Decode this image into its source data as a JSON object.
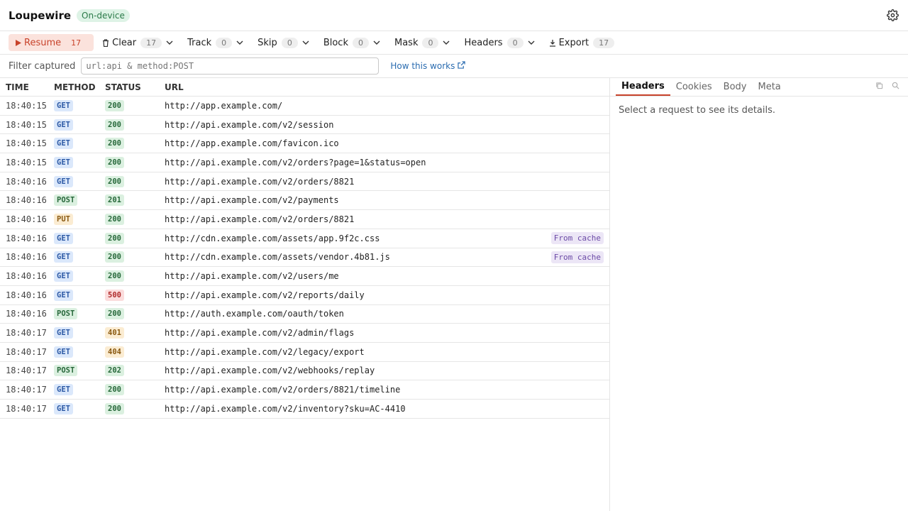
{
  "app": {
    "title": "Loupewire",
    "mode_badge": "On-device"
  },
  "toolbar": {
    "resume": {
      "label": "Resume",
      "count": "17"
    },
    "clear": {
      "label": "Clear",
      "count": "17"
    },
    "track": {
      "label": "Track",
      "count": "0"
    },
    "skip": {
      "label": "Skip",
      "count": "0"
    },
    "block": {
      "label": "Block",
      "count": "0"
    },
    "mask": {
      "label": "Mask",
      "count": "0"
    },
    "headers": {
      "label": "Headers",
      "count": "0"
    },
    "export": {
      "label": "Export",
      "count": "17"
    }
  },
  "filter": {
    "label": "Filter captured",
    "placeholder": "url:api & method:POST",
    "value": "",
    "help_link": "How this works"
  },
  "table": {
    "columns": {
      "time": "TIME",
      "method": "METHOD",
      "status": "STATUS",
      "url": "URL"
    },
    "rows": [
      {
        "time": "18:40:15",
        "method": "GET",
        "status": "200",
        "url": "http://app.example.com/",
        "note": ""
      },
      {
        "time": "18:40:15",
        "method": "GET",
        "status": "200",
        "url": "http://api.example.com/v2/session",
        "note": ""
      },
      {
        "time": "18:40:15",
        "method": "GET",
        "status": "200",
        "url": "http://app.example.com/favicon.ico",
        "note": ""
      },
      {
        "time": "18:40:15",
        "method": "GET",
        "status": "200",
        "url": "http://api.example.com/v2/orders?page=1&status=open",
        "note": ""
      },
      {
        "time": "18:40:16",
        "method": "GET",
        "status": "200",
        "url": "http://api.example.com/v2/orders/8821",
        "note": ""
      },
      {
        "time": "18:40:16",
        "method": "POST",
        "status": "201",
        "url": "http://api.example.com/v2/payments",
        "note": ""
      },
      {
        "time": "18:40:16",
        "method": "PUT",
        "status": "200",
        "url": "http://api.example.com/v2/orders/8821",
        "note": ""
      },
      {
        "time": "18:40:16",
        "method": "GET",
        "status": "200",
        "url": "http://cdn.example.com/assets/app.9f2c.css",
        "note": "From cache"
      },
      {
        "time": "18:40:16",
        "method": "GET",
        "status": "200",
        "url": "http://cdn.example.com/assets/vendor.4b81.js",
        "note": "From cache"
      },
      {
        "time": "18:40:16",
        "method": "GET",
        "status": "200",
        "url": "http://api.example.com/v2/users/me",
        "note": ""
      },
      {
        "time": "18:40:16",
        "method": "GET",
        "status": "500",
        "url": "http://api.example.com/v2/reports/daily",
        "note": ""
      },
      {
        "time": "18:40:16",
        "method": "POST",
        "status": "200",
        "url": "http://auth.example.com/oauth/token",
        "note": ""
      },
      {
        "time": "18:40:17",
        "method": "GET",
        "status": "401",
        "url": "http://api.example.com/v2/admin/flags",
        "note": ""
      },
      {
        "time": "18:40:17",
        "method": "GET",
        "status": "404",
        "url": "http://api.example.com/v2/legacy/export",
        "note": ""
      },
      {
        "time": "18:40:17",
        "method": "POST",
        "status": "202",
        "url": "http://api.example.com/v2/webhooks/replay",
        "note": ""
      },
      {
        "time": "18:40:17",
        "method": "GET",
        "status": "200",
        "url": "http://api.example.com/v2/orders/8821/timeline",
        "note": ""
      },
      {
        "time": "18:40:17",
        "method": "GET",
        "status": "200",
        "url": "http://api.example.com/v2/inventory?sku=AC-4410",
        "note": ""
      }
    ]
  },
  "details": {
    "tabs": [
      "Headers",
      "Cookies",
      "Body",
      "Meta"
    ],
    "active_tab": "Headers",
    "empty_message": "Select a request to see its details."
  },
  "colors": {
    "accent": "#c8432b",
    "link": "#2b6cb0"
  }
}
